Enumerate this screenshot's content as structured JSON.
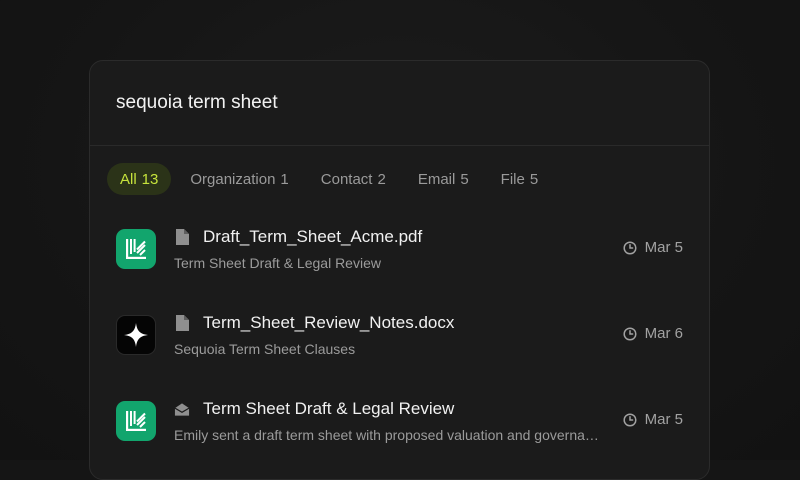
{
  "search": {
    "value": "sequoia term sheet"
  },
  "filters": [
    {
      "label": "All",
      "count": "13",
      "active": true
    },
    {
      "label": "Organization",
      "count": "1",
      "active": false
    },
    {
      "label": "Contact",
      "count": "2",
      "active": false
    },
    {
      "label": "Email",
      "count": "5",
      "active": false
    },
    {
      "label": "File",
      "count": "5",
      "active": false
    }
  ],
  "results": [
    {
      "app_icon": "ledger-green-app-icon",
      "type_icon": "file-icon",
      "title": "Draft_Term_Sheet_Acme.pdf",
      "subtitle": "Term Sheet Draft & Legal Review",
      "date": "Mar 5"
    },
    {
      "app_icon": "sparkle-black-app-icon",
      "type_icon": "file-icon",
      "title": "Term_Sheet_Review_Notes.docx",
      "subtitle": "Sequoia Term Sheet Clauses",
      "date": "Mar 6"
    },
    {
      "app_icon": "ledger-green-app-icon",
      "type_icon": "mail-icon",
      "title": "Term Sheet Draft & Legal Review",
      "subtitle": "Emily sent a draft term sheet with proposed valuation and governance terms",
      "date": "Mar 5"
    }
  ],
  "colors": {
    "accent": "#c6e33c",
    "accent_bg": "#2b3318",
    "app_green": "#12a56d",
    "panel": "#1b1b1b",
    "background": "#151515"
  }
}
